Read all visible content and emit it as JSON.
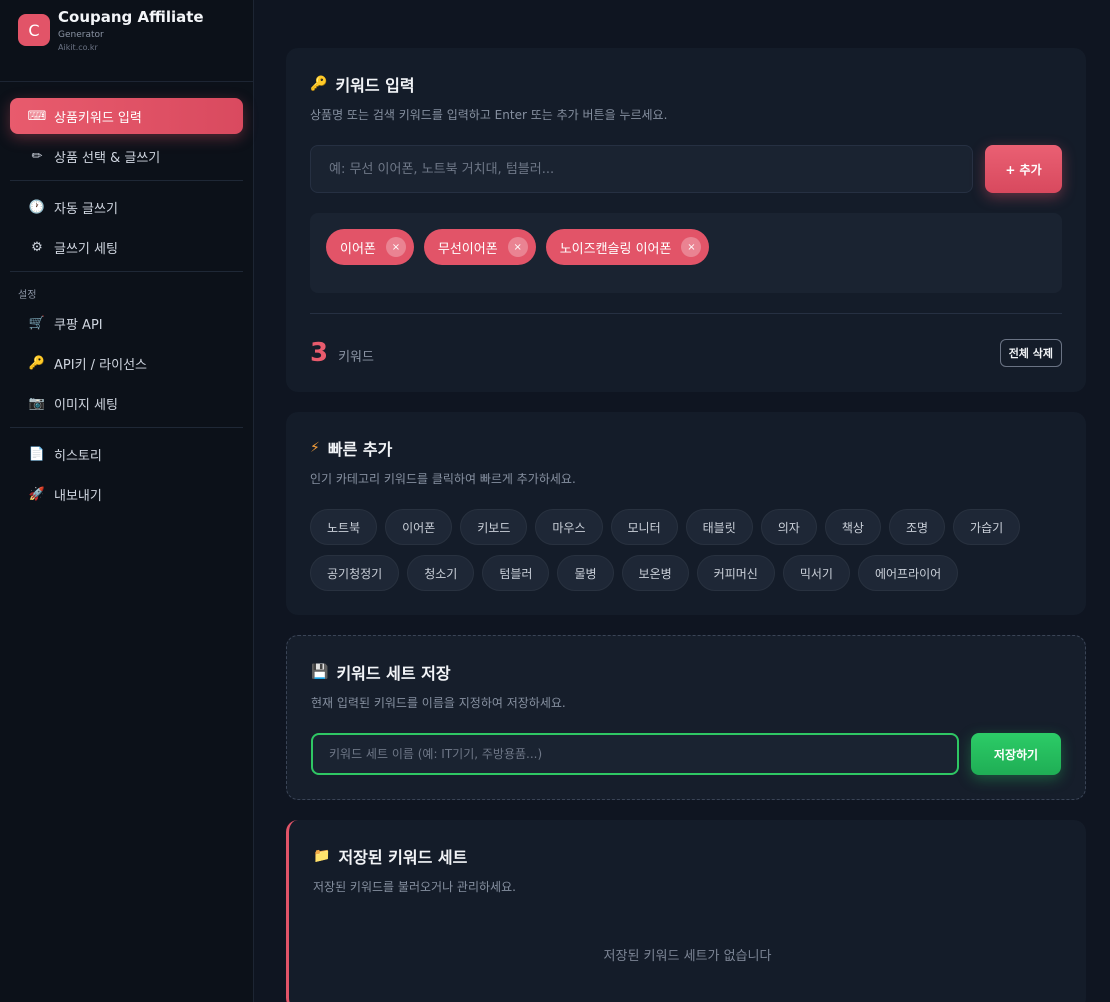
{
  "brand": {
    "logo": "C",
    "title": "Coupang Affiliate",
    "subtitle": "Generator",
    "url": "Aikit.co.kr"
  },
  "sidebar": {
    "items": [
      {
        "icon": "⌨",
        "icon_name": "keyboard-icon",
        "label": "상품키워드 입력",
        "active": true
      },
      {
        "icon": "✏",
        "icon_name": "pencil-icon",
        "label": "상품 선택 & 글쓰기"
      },
      {
        "icon": "🕐",
        "icon_name": "clock-icon",
        "label": "자동 글쓰기"
      },
      {
        "icon": "⚙",
        "icon_name": "gear-icon",
        "label": "글쓰기 세팅"
      },
      {
        "icon": "🛒",
        "icon_name": "cart-icon",
        "label": "쿠팡 API"
      },
      {
        "icon": "🔑",
        "icon_name": "key-icon",
        "label": "API키 / 라이선스"
      },
      {
        "icon": "📷",
        "icon_name": "camera-icon",
        "label": "이미지 세팅"
      },
      {
        "icon": "📄",
        "icon_name": "document-icon",
        "label": "히스토리"
      },
      {
        "icon": "🚀",
        "icon_name": "rocket-icon",
        "label": "내보내기"
      }
    ],
    "section_settings": "설정"
  },
  "keyword_input": {
    "icon": "🔑",
    "title": "키워드 입력",
    "description": "상품명 또는 검색 키워드를 입력하고 Enter 또는 추가 버튼을 누르세요.",
    "placeholder": "예: 무선 이어폰, 노트북 거치대, 텀블러...",
    "add_label": "+ 추가",
    "tags": [
      "이어폰",
      "무선이어폰",
      "노이즈캔슬링 이어폰"
    ],
    "remove_symbol": "×",
    "count": "3",
    "count_label": "키워드",
    "clear_label": "전체 삭제"
  },
  "quick_add": {
    "icon": "⚡",
    "title": "빠른 추가",
    "description": "인기 카테고리 키워드를 클릭하여 빠르게 추가하세요.",
    "chips": [
      "노트북",
      "이어폰",
      "키보드",
      "마우스",
      "모니터",
      "태블릿",
      "의자",
      "책상",
      "조명",
      "가습기",
      "공기청정기",
      "청소기",
      "텀블러",
      "물병",
      "보온병",
      "커피머신",
      "믹서기",
      "에어프라이어"
    ]
  },
  "save_set": {
    "icon": "💾",
    "title": "키워드 세트 저장",
    "description": "현재 입력된 키워드를 이름을 지정하여 저장하세요.",
    "placeholder": "키워드 세트 이름 (예: IT기기, 주방용품...)",
    "save_label": "저장하기"
  },
  "saved_sets": {
    "icon": "📁",
    "title": "저장된 키워드 세트",
    "description": "저장된 키워드를 불러오거나 관리하세요.",
    "empty_text": "저장된 키워드 세트가 없습니다"
  },
  "colors": {
    "accent": "#e25468",
    "success": "#2fc764",
    "background": "#0f1521",
    "card": "#141c29"
  }
}
